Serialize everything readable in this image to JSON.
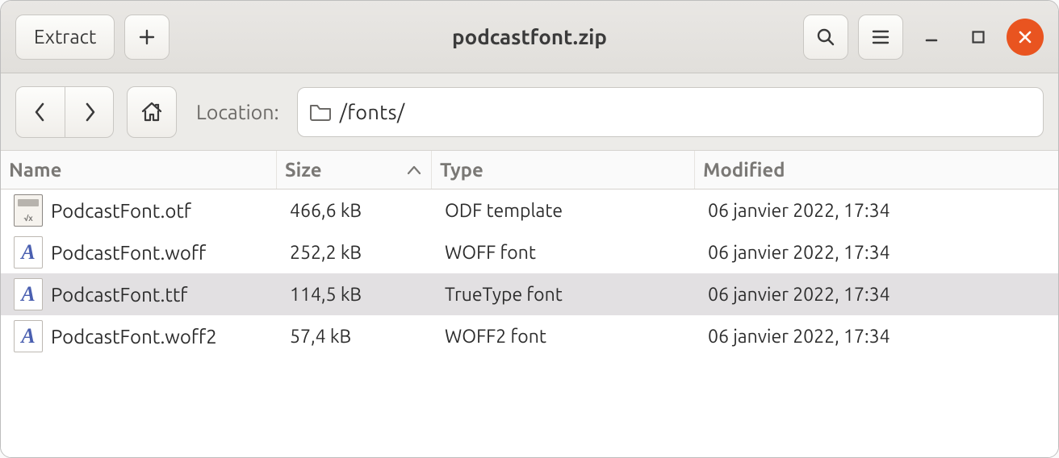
{
  "header": {
    "extract_label": "Extract",
    "title": "podcastfont.zip"
  },
  "toolbar": {
    "location_label": "Location:",
    "path": "/fonts/"
  },
  "columns": {
    "name": "Name",
    "size": "Size",
    "type": "Type",
    "modified": "Modified",
    "sort_column": "size",
    "sort_direction": "asc"
  },
  "files": [
    {
      "icon": "odf",
      "name": "PodcastFont.otf",
      "size": "466,6 kB",
      "type": "ODF template",
      "modified": "06 janvier 2022, 17:34",
      "selected": false
    },
    {
      "icon": "font",
      "name": "PodcastFont.woff",
      "size": "252,2 kB",
      "type": "WOFF font",
      "modified": "06 janvier 2022, 17:34",
      "selected": false
    },
    {
      "icon": "font",
      "name": "PodcastFont.ttf",
      "size": "114,5 kB",
      "type": "TrueType font",
      "modified": "06 janvier 2022, 17:34",
      "selected": true
    },
    {
      "icon": "font",
      "name": "PodcastFont.woff2",
      "size": "57,4 kB",
      "type": "WOFF2 font",
      "modified": "06 janvier 2022, 17:34",
      "selected": false
    }
  ]
}
